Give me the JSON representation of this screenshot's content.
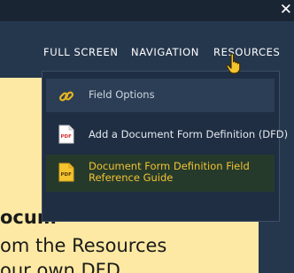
{
  "window": {
    "close_glyph": "✕",
    "close_icon": "close-icon"
  },
  "nav": {
    "fullscreen_label": "FULL SCREEN",
    "navigation_label": "NAVIGATION",
    "resources_label": "RESOURCES"
  },
  "resources_menu": {
    "items": [
      {
        "label": "Field Options",
        "icon": "link-icon"
      },
      {
        "label": "Add a Document Form Definition (DFD)",
        "icon": "pdf-file-icon"
      },
      {
        "label_line1": "Document Form Definition Field",
        "label_line2": "Reference Guide",
        "icon": "pdf-file-icon"
      }
    ],
    "pdf_icon_text": "PDF"
  },
  "document": {
    "line1": "ocum",
    "line2": "om the Resources",
    "line3": "our own DFD"
  },
  "colors": {
    "background": "#25374d",
    "document_bg": "#fde9a3",
    "menu_bg": "#1f2e42",
    "highlight_text": "#f1c232",
    "link_icon": "#e6b51e"
  },
  "cursor": {
    "icon": "hand-pointer-icon"
  }
}
